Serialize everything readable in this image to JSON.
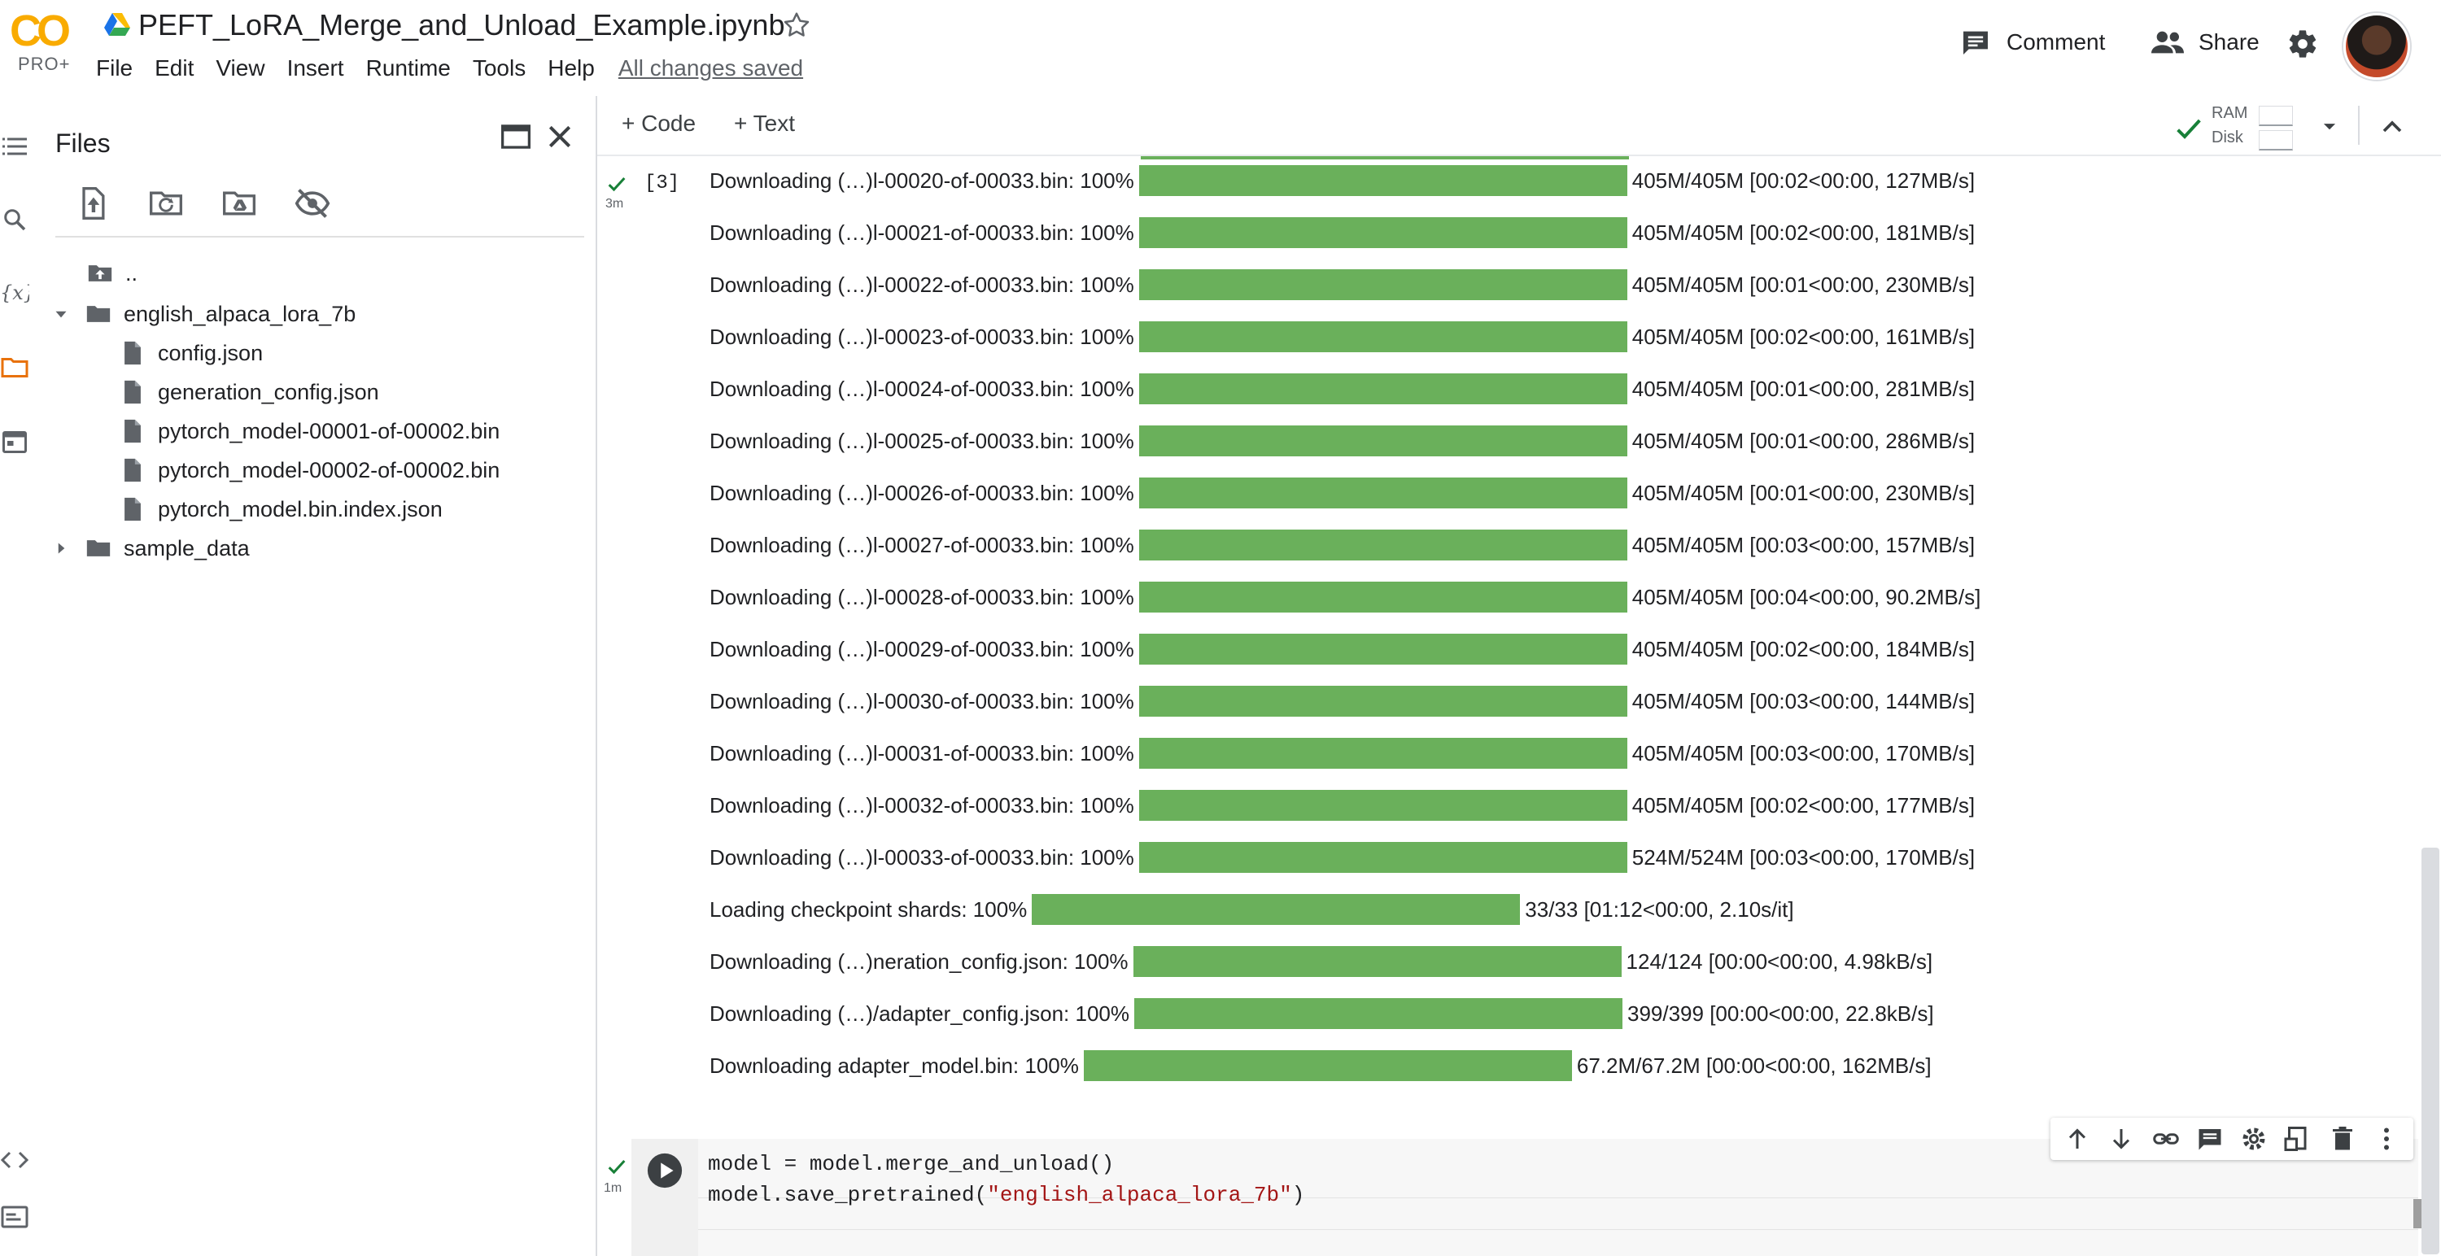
{
  "header": {
    "logo_text": "CO",
    "logo_tier": "PRO+",
    "title": "PEFT_LoRA_Merge_and_Unload_Example.ipynb",
    "menu": [
      "File",
      "Edit",
      "View",
      "Insert",
      "Runtime",
      "Tools",
      "Help"
    ],
    "save_status": "All changes saved",
    "comment_label": "Comment",
    "share_label": "Share"
  },
  "files_panel": {
    "title": "Files",
    "tree": {
      "parent": "..",
      "folder": "english_alpaca_lora_7b",
      "files": [
        "config.json",
        "generation_config.json",
        "pytorch_model-00001-of-00002.bin",
        "pytorch_model-00002-of-00002.bin",
        "pytorch_model.bin.index.json"
      ],
      "collapsed_folder": "sample_data"
    }
  },
  "toolbar": {
    "add_code": "+ Code",
    "add_text": "+ Text",
    "ram_label": "RAM",
    "disk_label": "Disk"
  },
  "cell3": {
    "exec_count": "[3]",
    "duration": "3m",
    "outputs": [
      {
        "label": "Downloading (…)l-00020-of-00033.bin: 100%",
        "progress": 1.0,
        "stats": "405M/405M [00:02<00:00, 127MB/s]"
      },
      {
        "label": "Downloading (…)l-00021-of-00033.bin: 100%",
        "progress": 1.0,
        "stats": "405M/405M [00:02<00:00, 181MB/s]"
      },
      {
        "label": "Downloading (…)l-00022-of-00033.bin: 100%",
        "progress": 1.0,
        "stats": "405M/405M [00:01<00:00, 230MB/s]"
      },
      {
        "label": "Downloading (…)l-00023-of-00033.bin: 100%",
        "progress": 1.0,
        "stats": "405M/405M [00:02<00:00, 161MB/s]"
      },
      {
        "label": "Downloading (…)l-00024-of-00033.bin: 100%",
        "progress": 1.0,
        "stats": "405M/405M [00:01<00:00, 281MB/s]"
      },
      {
        "label": "Downloading (…)l-00025-of-00033.bin: 100%",
        "progress": 1.0,
        "stats": "405M/405M [00:01<00:00, 286MB/s]"
      },
      {
        "label": "Downloading (…)l-00026-of-00033.bin: 100%",
        "progress": 1.0,
        "stats": "405M/405M [00:01<00:00, 230MB/s]"
      },
      {
        "label": "Downloading (…)l-00027-of-00033.bin: 100%",
        "progress": 1.0,
        "stats": "405M/405M [00:03<00:00, 157MB/s]"
      },
      {
        "label": "Downloading (…)l-00028-of-00033.bin: 100%",
        "progress": 1.0,
        "stats": "405M/405M [00:04<00:00, 90.2MB/s]"
      },
      {
        "label": "Downloading (…)l-00029-of-00033.bin: 100%",
        "progress": 1.0,
        "stats": "405M/405M [00:02<00:00, 184MB/s]"
      },
      {
        "label": "Downloading (…)l-00030-of-00033.bin: 100%",
        "progress": 1.0,
        "stats": "405M/405M [00:03<00:00, 144MB/s]"
      },
      {
        "label": "Downloading (…)l-00031-of-00033.bin: 100%",
        "progress": 1.0,
        "stats": "405M/405M [00:03<00:00, 170MB/s]"
      },
      {
        "label": "Downloading (…)l-00032-of-00033.bin: 100%",
        "progress": 1.0,
        "stats": "405M/405M [00:02<00:00, 177MB/s]"
      },
      {
        "label": "Downloading (…)l-00033-of-00033.bin: 100%",
        "progress": 1.0,
        "stats": "524M/524M [00:03<00:00, 170MB/s]"
      },
      {
        "label": "Loading checkpoint shards: 100%",
        "progress": 1.0,
        "stats": "33/33 [01:12<00:00, 2.10s/it]"
      },
      {
        "label": "Downloading (…)neration_config.json: 100%",
        "progress": 1.0,
        "stats": "124/124 [00:00<00:00, 4.98kB/s]"
      },
      {
        "label": "Downloading (…)/adapter_config.json: 100%",
        "progress": 1.0,
        "stats": "399/399 [00:00<00:00, 22.8kB/s]"
      },
      {
        "label": "Downloading adapter_model.bin: 100%",
        "progress": 1.0,
        "stats": "67.2M/67.2M [00:00<00:00, 162MB/s]"
      }
    ]
  },
  "cell4": {
    "duration": "1m",
    "code_line1": "model = model.merge_and_unload()",
    "code_line2_prefix": "model.save_pretrained(",
    "code_line2_string": "\"english_alpaca_lora_7b\"",
    "code_line2_suffix": ")"
  },
  "colors": {
    "progress_fill": "#6ab05b",
    "logo_orange": "#f9ab00",
    "active_rail": "#e8710a",
    "success_check": "#188038"
  },
  "icons": {
    "rail": [
      "table-of-contents-icon",
      "search-icon",
      "variables-icon",
      "folder-icon",
      "calendar-icon",
      "code-snippets-icon",
      "terminal-icon"
    ],
    "files_tools": [
      "upload-icon",
      "refresh-icon",
      "mount-drive-icon",
      "hide-files-icon"
    ],
    "cell_toolbar": [
      "move-up-icon",
      "move-down-icon",
      "link-icon",
      "comment-icon",
      "settings-icon",
      "mirror-cell-icon",
      "delete-icon",
      "more-icon"
    ]
  }
}
